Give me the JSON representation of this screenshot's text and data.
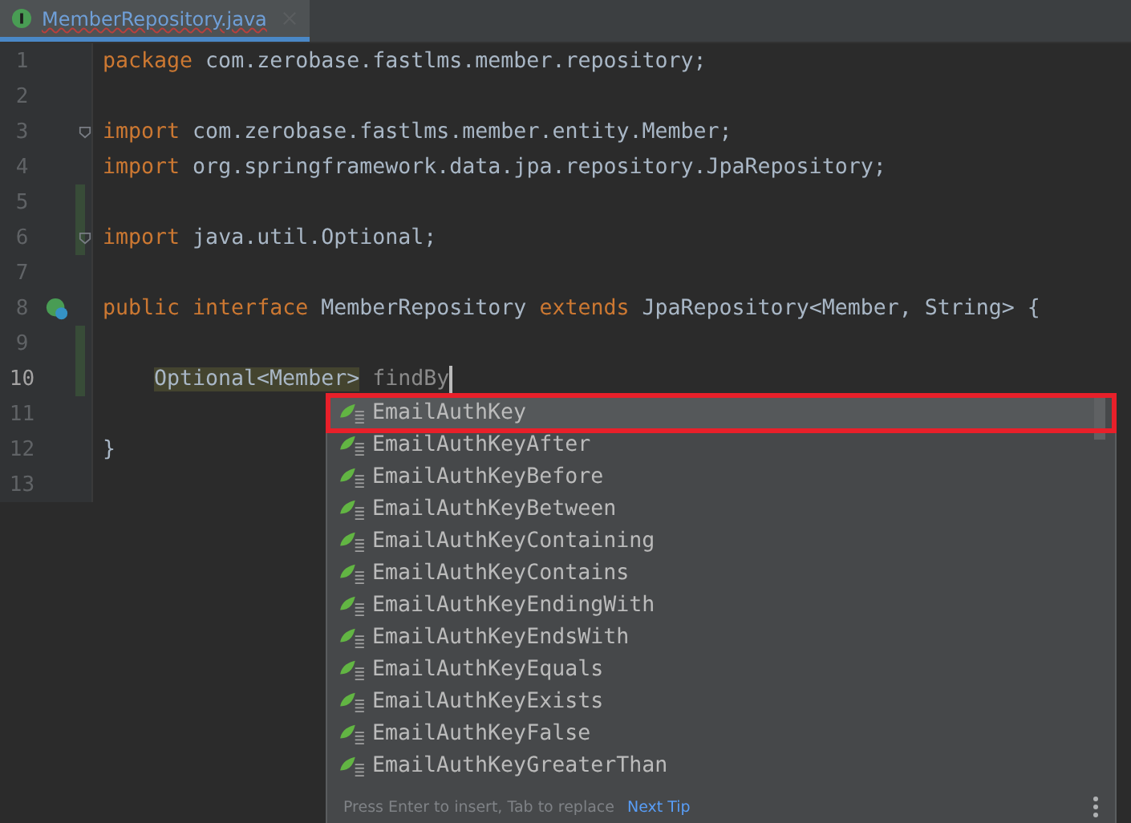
{
  "tab": {
    "title": "MemberRepository.java",
    "selected": true
  },
  "lines": [
    {
      "number": "1",
      "current": false,
      "changed": false,
      "fold": false,
      "bean": false,
      "tokens": [
        {
          "kind": "keyword",
          "text": "package"
        },
        {
          "kind": "plain",
          "text": " com.zerobase.fastlms.member.repository;"
        }
      ]
    },
    {
      "number": "2",
      "current": false,
      "changed": false,
      "fold": false,
      "bean": false
    },
    {
      "number": "3",
      "current": false,
      "changed": false,
      "fold": true,
      "bean": false,
      "tokens": [
        {
          "kind": "keyword",
          "text": "import"
        },
        {
          "kind": "plain",
          "text": " com.zerobase.fastlms.member.entity.Member;"
        }
      ]
    },
    {
      "number": "4",
      "current": false,
      "changed": false,
      "fold": false,
      "bean": false,
      "tokens": [
        {
          "kind": "keyword",
          "text": "import"
        },
        {
          "kind": "plain",
          "text": " org.springframework.data.jpa.repository.JpaRepository;"
        }
      ]
    },
    {
      "number": "5",
      "current": false,
      "changed": true,
      "fold": false,
      "bean": false
    },
    {
      "number": "6",
      "current": false,
      "changed": true,
      "fold": true,
      "bean": false,
      "tokens": [
        {
          "kind": "keyword",
          "text": "import"
        },
        {
          "kind": "plain",
          "text": " java.util.Optional;"
        }
      ]
    },
    {
      "number": "7",
      "current": false,
      "changed": false,
      "fold": false,
      "bean": false
    },
    {
      "number": "8",
      "current": false,
      "changed": false,
      "fold": false,
      "bean": true,
      "tokens": [
        {
          "kind": "keyword",
          "text": "public interface"
        },
        {
          "kind": "plain",
          "text": " MemberRepository "
        },
        {
          "kind": "keyword",
          "text": "extends"
        },
        {
          "kind": "plain",
          "text": " JpaRepository<Member, String> {"
        }
      ]
    },
    {
      "number": "9",
      "current": false,
      "changed": true,
      "fold": false,
      "bean": false
    },
    {
      "number": "10",
      "current": true,
      "changed": true,
      "fold": false,
      "bean": false,
      "indented": true,
      "caret": true,
      "tokens": [
        {
          "kind": "highlight",
          "text": "Optional<Member>"
        },
        {
          "kind": "hint",
          "text": "findBy"
        }
      ]
    },
    {
      "number": "11",
      "current": false,
      "changed": false,
      "fold": false,
      "bean": false
    },
    {
      "number": "12",
      "current": false,
      "changed": false,
      "fold": false,
      "bean": false,
      "tokens": [
        {
          "kind": "plain",
          "text": "}"
        }
      ]
    },
    {
      "number": "13",
      "current": false,
      "changed": false,
      "fold": false,
      "bean": false
    }
  ],
  "completion": {
    "items": [
      {
        "label": "EmailAuthKey",
        "selected": true
      },
      {
        "label": "EmailAuthKeyAfter",
        "selected": false
      },
      {
        "label": "EmailAuthKeyBefore",
        "selected": false
      },
      {
        "label": "EmailAuthKeyBetween",
        "selected": false
      },
      {
        "label": "EmailAuthKeyContaining",
        "selected": false
      },
      {
        "label": "EmailAuthKeyContains",
        "selected": false
      },
      {
        "label": "EmailAuthKeyEndingWith",
        "selected": false
      },
      {
        "label": "EmailAuthKeyEndsWith",
        "selected": false
      },
      {
        "label": "EmailAuthKeyEquals",
        "selected": false
      },
      {
        "label": "EmailAuthKeyExists",
        "selected": false
      },
      {
        "label": "EmailAuthKeyFalse",
        "selected": false
      },
      {
        "label": "EmailAuthKeyGreaterThan",
        "selected": false
      }
    ],
    "footer_hint": "Press Enter to insert, Tab to replace",
    "footer_link": "Next Tip"
  }
}
